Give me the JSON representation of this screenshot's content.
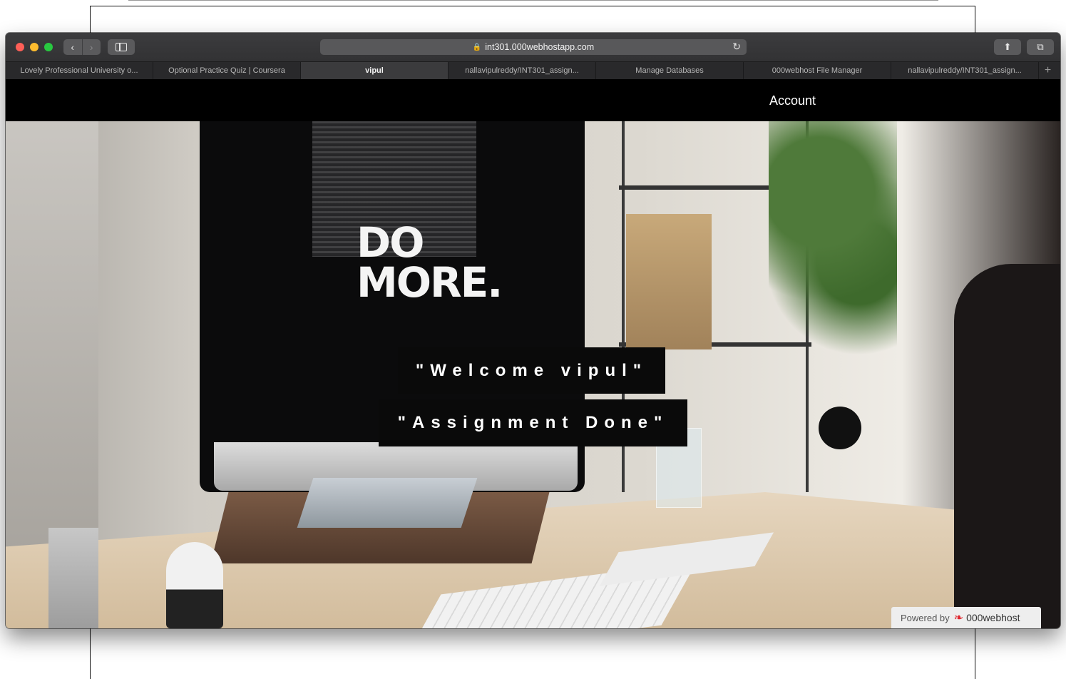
{
  "browser": {
    "url": "int301.000webhostapp.com",
    "tabs": [
      {
        "label": "Lovely Professional University o...",
        "active": false
      },
      {
        "label": "Optional Practice Quiz | Coursera",
        "active": false
      },
      {
        "label": "vipul",
        "active": true
      },
      {
        "label": "nallavipulreddy/INT301_assign...",
        "active": false
      },
      {
        "label": "Manage Databases",
        "active": false
      },
      {
        "label": "000webhost File Manager",
        "active": false
      },
      {
        "label": "nallavipulreddy/INT301_assign...",
        "active": false
      }
    ],
    "icons": {
      "back": "chevron-left-icon",
      "forward": "chevron-right-icon",
      "sidebar": "sidebar-icon",
      "lock": "lock-icon",
      "reload": "reload-icon",
      "share": "share-icon",
      "tabs": "tabs-overview-icon",
      "new_tab": "plus-icon"
    }
  },
  "page": {
    "nav": {
      "account": "Account"
    },
    "hero": {
      "image_text_line1": "DO",
      "image_text_line2": "MORE.",
      "welcome": "\"Welcome vipul\"",
      "assignment": "\"Assignment Done\""
    },
    "footer_badge": {
      "prefix": "Powered by",
      "brand": "000webhost"
    }
  },
  "colors": {
    "nav_bg": "#000000",
    "text_box_bg": "#0a0a0a",
    "badge_bg": "#eeeeee",
    "brand_red": "#e0262e"
  }
}
